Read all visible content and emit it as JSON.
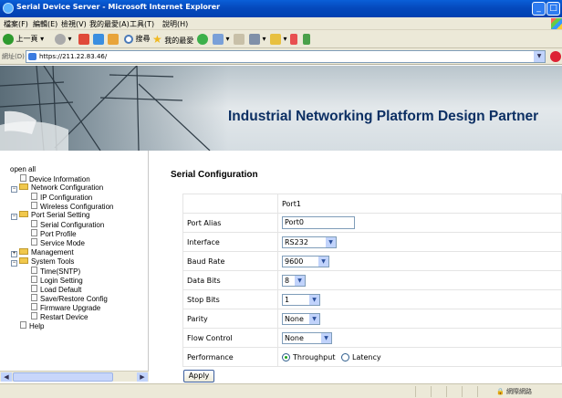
{
  "window": {
    "title": "Serial Device Server - Microsoft Internet Explorer"
  },
  "menu": [
    "檔案(F)",
    "編輯(E)",
    "檢視(V)",
    "我的最愛(A)",
    "工具(T)",
    "說明(H)"
  ],
  "toolbar": {
    "back": "上一頁",
    "search": "搜尋",
    "favorites": "我的最愛"
  },
  "address": {
    "label": "網址(D)",
    "url": "https://211.22.83.46/"
  },
  "banner": {
    "tagline": "Industrial Networking Platform Design Partner"
  },
  "sidebar": {
    "open_all": "open all",
    "items": [
      {
        "label": "Device Information"
      },
      {
        "label": "Network Configuration"
      },
      {
        "label": "IP Configuration"
      },
      {
        "label": "Wireless Configuration"
      },
      {
        "label": "Port Serial Setting"
      },
      {
        "label": "Serial Configuration"
      },
      {
        "label": "Port Profile"
      },
      {
        "label": "Service Mode"
      },
      {
        "label": "Management"
      },
      {
        "label": "System Tools"
      },
      {
        "label": "Time(SNTP)"
      },
      {
        "label": "Login Setting"
      },
      {
        "label": "Load Default"
      },
      {
        "label": "Save/Restore Config"
      },
      {
        "label": "Firmware Upgrade"
      },
      {
        "label": "Restart Device"
      },
      {
        "label": "Help"
      }
    ]
  },
  "content": {
    "title": "Serial Configuration",
    "column_header": "Port1",
    "fields": {
      "port_alias": {
        "label": "Port Alias",
        "value": "Port0"
      },
      "interface": {
        "label": "Interface",
        "value": "RS232"
      },
      "baud_rate": {
        "label": "Baud Rate",
        "value": "9600"
      },
      "data_bits": {
        "label": "Data Bits",
        "value": "8"
      },
      "stop_bits": {
        "label": "Stop Bits",
        "value": "1"
      },
      "parity": {
        "label": "Parity",
        "value": "None"
      },
      "flow_control": {
        "label": "Flow Control",
        "value": "None"
      },
      "performance": {
        "label": "Performance",
        "option1": "Throughput",
        "option2": "Latency",
        "selected": "Throughput"
      }
    },
    "apply_label": "Apply"
  },
  "status": {
    "zone": "網際網路"
  }
}
